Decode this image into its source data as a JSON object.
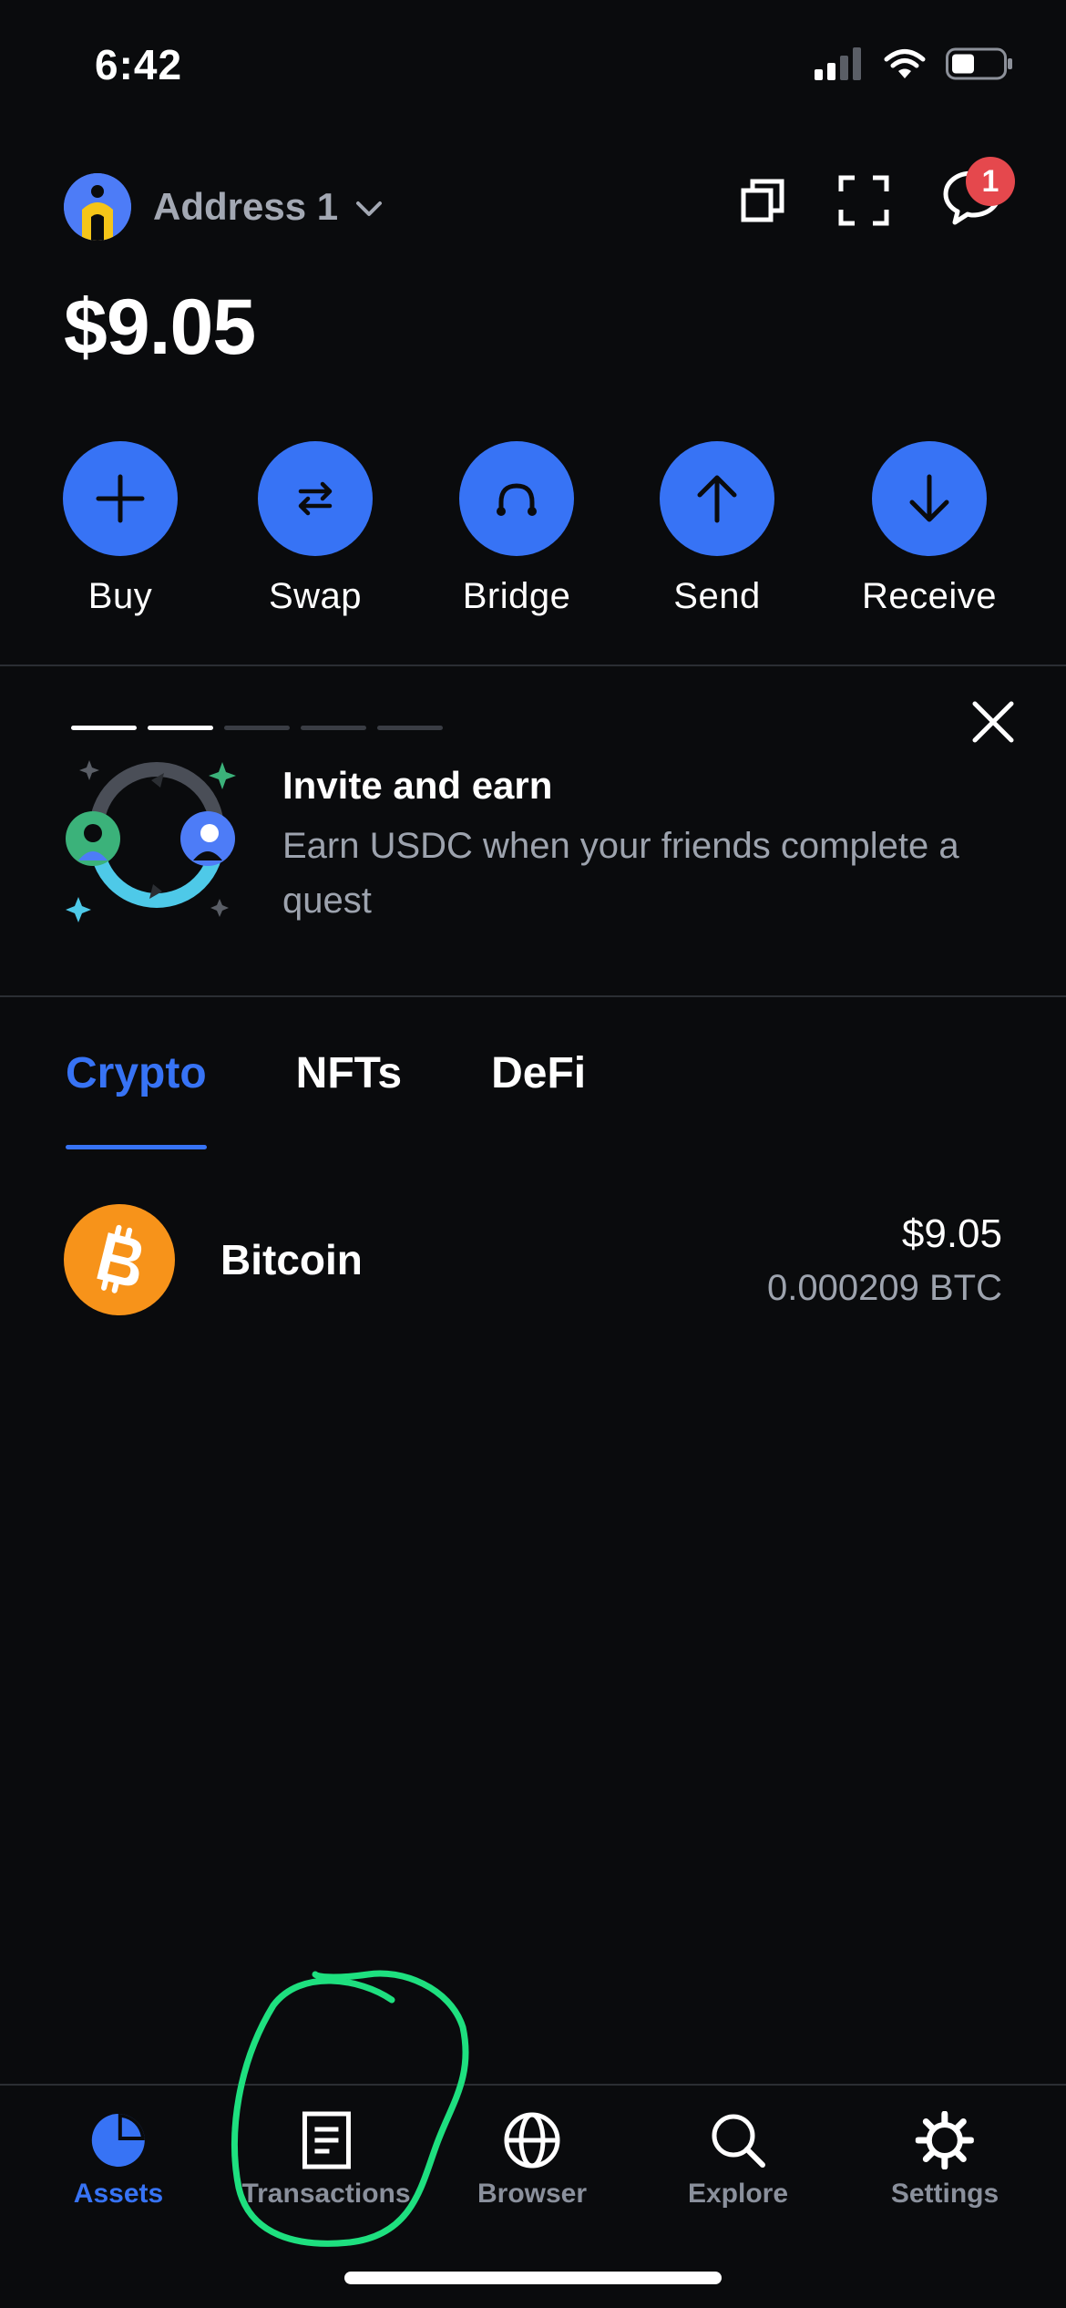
{
  "status_bar": {
    "time": "6:42"
  },
  "header": {
    "address_label": "Address 1",
    "notification_count": "1",
    "icons": [
      "copy-icon",
      "scan-icon",
      "chat-icon"
    ]
  },
  "balance": "$9.05",
  "actions": [
    {
      "label": "Buy",
      "icon": "plus-icon"
    },
    {
      "label": "Swap",
      "icon": "swap-icon"
    },
    {
      "label": "Bridge",
      "icon": "bridge-icon"
    },
    {
      "label": "Send",
      "icon": "arrow-up-icon"
    },
    {
      "label": "Receive",
      "icon": "arrow-down-icon"
    }
  ],
  "promo": {
    "title": "Invite and earn",
    "description": "Earn USDC when your friends complete a quest",
    "pages_total": 5,
    "pages_seen": 2
  },
  "tabs": [
    {
      "label": "Crypto",
      "active": true
    },
    {
      "label": "NFTs",
      "active": false
    },
    {
      "label": "DeFi",
      "active": false
    }
  ],
  "assets": [
    {
      "name": "Bitcoin",
      "usd": "$9.05",
      "amount": "0.000209 BTC",
      "icon": "bitcoin-icon"
    }
  ],
  "bottom_nav": [
    {
      "label": "Assets",
      "icon": "pie-chart-icon",
      "active": true
    },
    {
      "label": "Transactions",
      "icon": "document-icon",
      "active": false
    },
    {
      "label": "Browser",
      "icon": "globe-icon",
      "active": false
    },
    {
      "label": "Explore",
      "icon": "search-icon",
      "active": false
    },
    {
      "label": "Settings",
      "icon": "gear-icon",
      "active": false
    }
  ],
  "colors": {
    "background": "#0a0b0d",
    "accent": "#3773f5",
    "muted_text": "#9da3ae",
    "badge": "#e5484d",
    "bitcoin": "#f7931a",
    "annotation_circle": "#1ee07f"
  }
}
